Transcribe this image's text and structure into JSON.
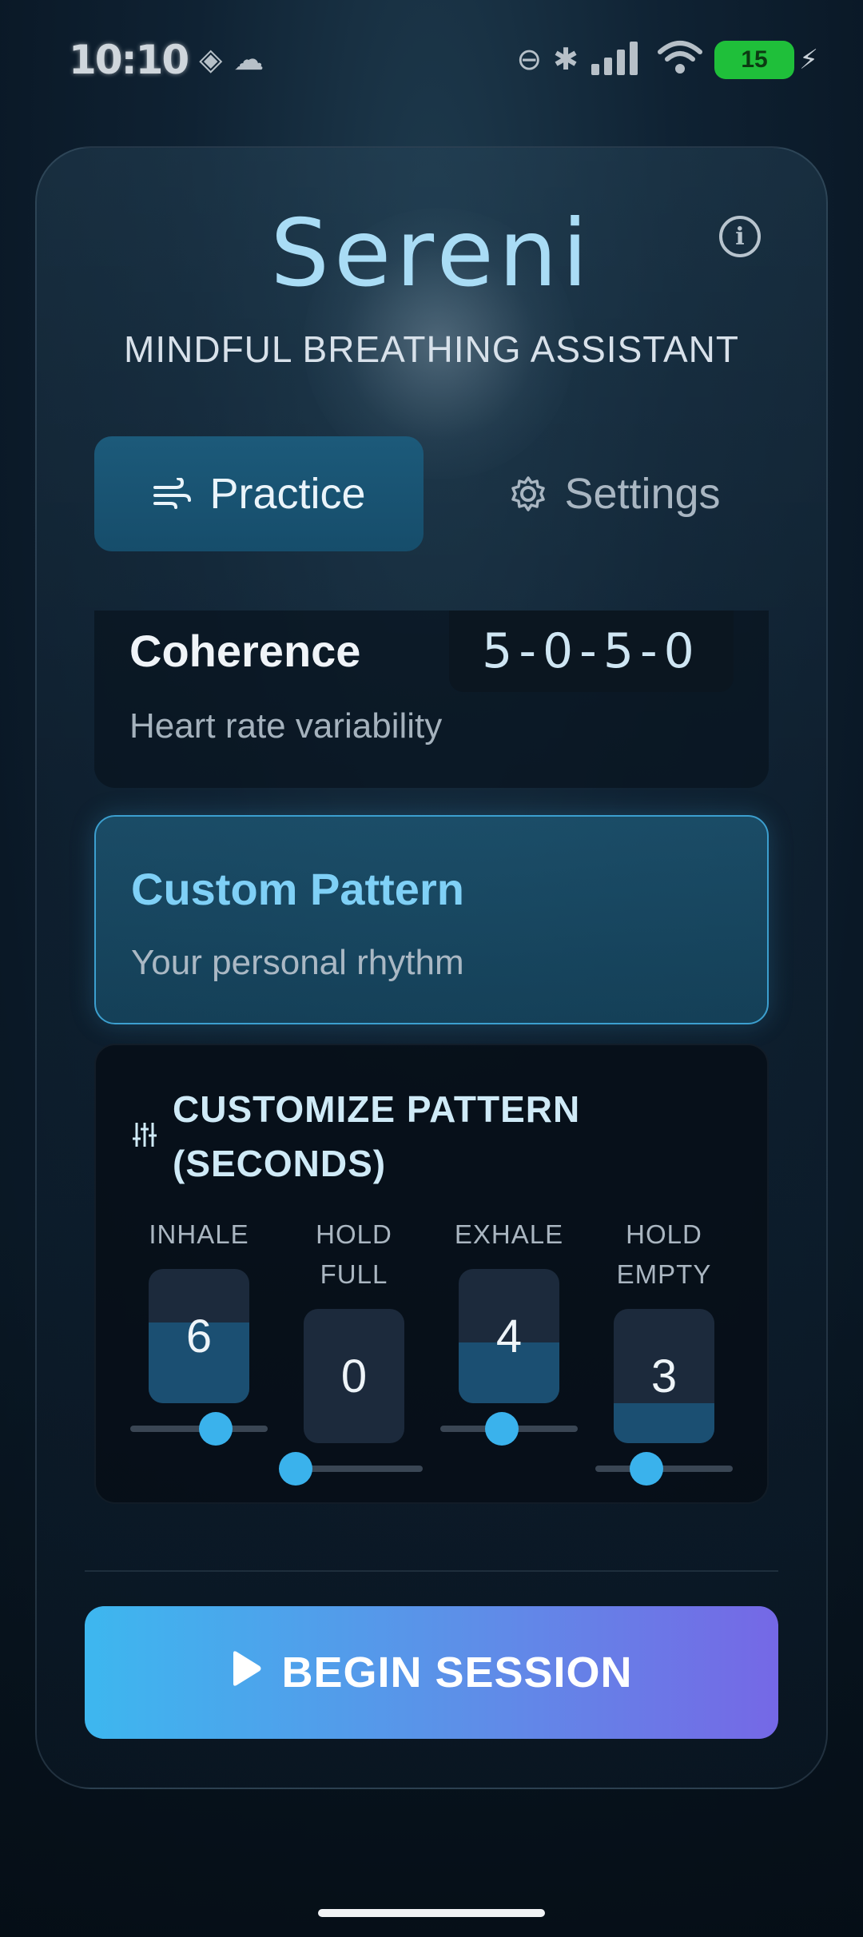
{
  "status_bar": {
    "time": "10:10",
    "battery": "15"
  },
  "app": {
    "title": "Sereni",
    "subtitle": "MINDFUL BREATHING ASSISTANT"
  },
  "tabs": [
    {
      "label": "Practice",
      "active": true
    },
    {
      "label": "Settings",
      "active": false
    }
  ],
  "patterns": {
    "coherence": {
      "name": "Coherence",
      "code": "5-0-5-0",
      "description": "Heart rate variability"
    },
    "custom": {
      "name": "Custom Pattern",
      "description": "Your personal rhythm",
      "selected": true
    }
  },
  "customize": {
    "title_line1": "CUSTOMIZE PATTERN",
    "title_line2": "(SECONDS)",
    "phases": [
      {
        "label_line1": "INHALE",
        "label_line2": "",
        "value": "6",
        "level": 0.6
      },
      {
        "label_line1": "HOLD",
        "label_line2": "FULL",
        "value": "0",
        "level": 0.0
      },
      {
        "label_line1": "EXHALE",
        "label_line2": "",
        "value": "4",
        "level": 0.45
      },
      {
        "label_line1": "HOLD",
        "label_line2": "EMPTY",
        "value": "3",
        "level": 0.3
      }
    ]
  },
  "actions": {
    "begin_label": "BEGIN SESSION"
  },
  "colors": {
    "accent": "#3ab2ec",
    "title": "#a9dcf5",
    "button_start": "#3db7ef",
    "button_end": "#7568e6"
  }
}
